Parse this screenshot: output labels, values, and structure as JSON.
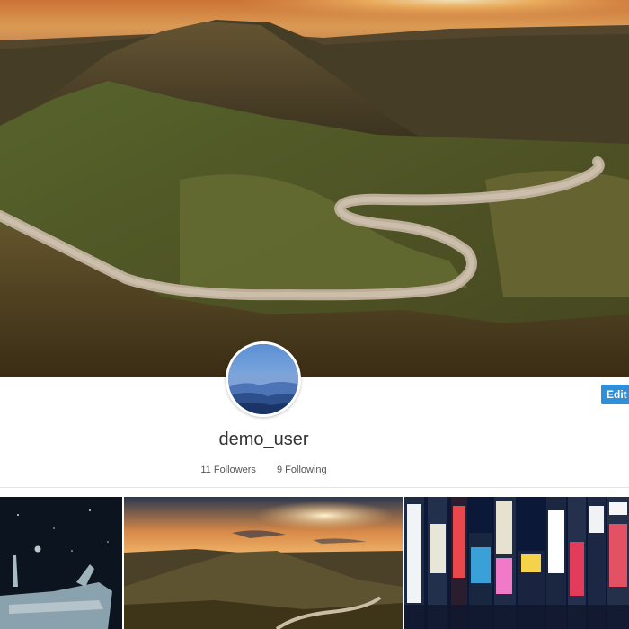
{
  "profile": {
    "username": "demo_user",
    "followers_label": "11 Followers",
    "following_label": "9 Following",
    "edit_button_label": "Edit P"
  },
  "posts": [
    {
      "name": "post-night-ship"
    },
    {
      "name": "post-sunset-hills"
    },
    {
      "name": "post-neon-city"
    }
  ]
}
